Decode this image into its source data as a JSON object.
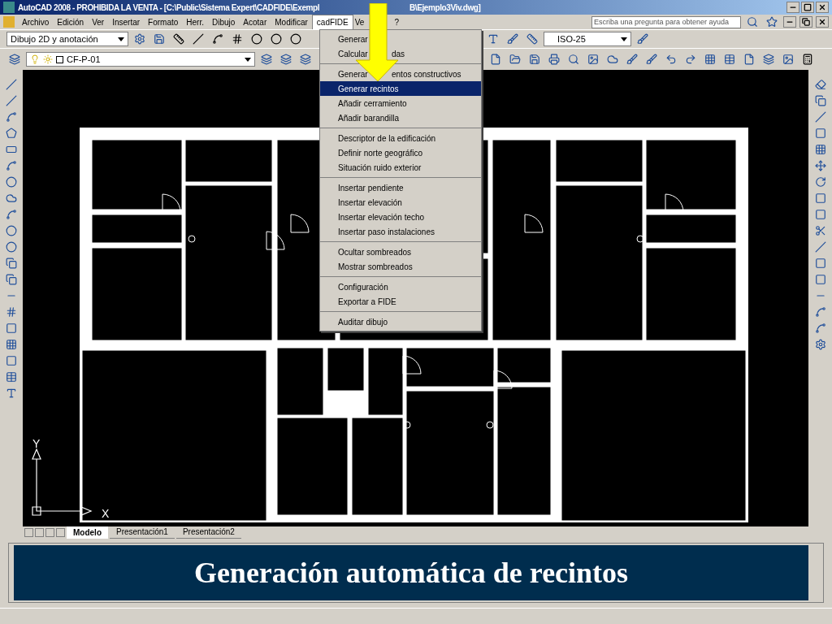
{
  "window": {
    "title_parts": [
      "AutoCAD 2008 - PROHIBIDA LA VENTA - [C:\\Public\\Sistema Expert\\CADFIDE\\Exempl",
      "B\\Ejemplo3Viv.dwg]"
    ]
  },
  "menu_bar": [
    {
      "label": "Archivo",
      "open": false
    },
    {
      "label": "Edición",
      "open": false
    },
    {
      "label": "Ver",
      "open": false
    },
    {
      "label": "Insertar",
      "open": false
    },
    {
      "label": "Formato",
      "open": false
    },
    {
      "label": "Herr.",
      "open": false
    },
    {
      "label": "Dibujo",
      "open": false
    },
    {
      "label": "Acotar",
      "open": false
    },
    {
      "label": "Modificar",
      "open": false
    },
    {
      "label": "cadFIDE",
      "open": true
    },
    {
      "label": "Ve",
      "open": false
    },
    {
      "label": "?",
      "open": false
    }
  ],
  "help_search": {
    "placeholder": "Escriba una pregunta para obtener ayuda"
  },
  "workspace_combo": {
    "value": "Dibujo 2D y anotación"
  },
  "dimstyle_combo": {
    "value": "ISO-25"
  },
  "layer_combo": {
    "value": "CF-P-01"
  },
  "dropdown": {
    "groups": [
      [
        {
          "parts": [
            "Generar"
          ],
          "selected": false
        },
        {
          "parts": [
            "Calcular",
            "das"
          ],
          "selected": false
        }
      ],
      [
        {
          "parts": [
            "Generar",
            "entos constructivos"
          ],
          "selected": false
        },
        {
          "parts": [
            "Generar recintos"
          ],
          "selected": true
        },
        {
          "parts": [
            "Añadir cerramiento"
          ],
          "selected": false
        },
        {
          "parts": [
            "Añadir barandilla"
          ],
          "selected": false
        }
      ],
      [
        {
          "parts": [
            "Descriptor de la edificación"
          ],
          "selected": false
        },
        {
          "parts": [
            "Definir norte geográfico"
          ],
          "selected": false
        },
        {
          "parts": [
            "Situación ruido exterior"
          ],
          "selected": false
        }
      ],
      [
        {
          "parts": [
            "Insertar pendiente"
          ],
          "selected": false
        },
        {
          "parts": [
            "Insertar elevación"
          ],
          "selected": false
        },
        {
          "parts": [
            "Insertar elevación techo"
          ],
          "selected": false
        },
        {
          "parts": [
            "Insertar paso instalaciones"
          ],
          "selected": false
        }
      ],
      [
        {
          "parts": [
            "Ocultar sombreados"
          ],
          "selected": false
        },
        {
          "parts": [
            "Mostrar sombreados"
          ],
          "selected": false
        }
      ],
      [
        {
          "parts": [
            "Configuración"
          ],
          "selected": false
        },
        {
          "parts": [
            "Exportar a FIDE"
          ],
          "selected": false
        }
      ],
      [
        {
          "parts": [
            "Auditar dibujo"
          ],
          "selected": false
        }
      ]
    ]
  },
  "ucs": {
    "y_label": "Y",
    "x_label": "X"
  },
  "layout_tabs": [
    {
      "label": "Modelo",
      "selected": true
    },
    {
      "label": "Presentación1",
      "selected": false
    },
    {
      "label": "Presentación2",
      "selected": false
    }
  ],
  "caption": "Generación automática de recintos"
}
